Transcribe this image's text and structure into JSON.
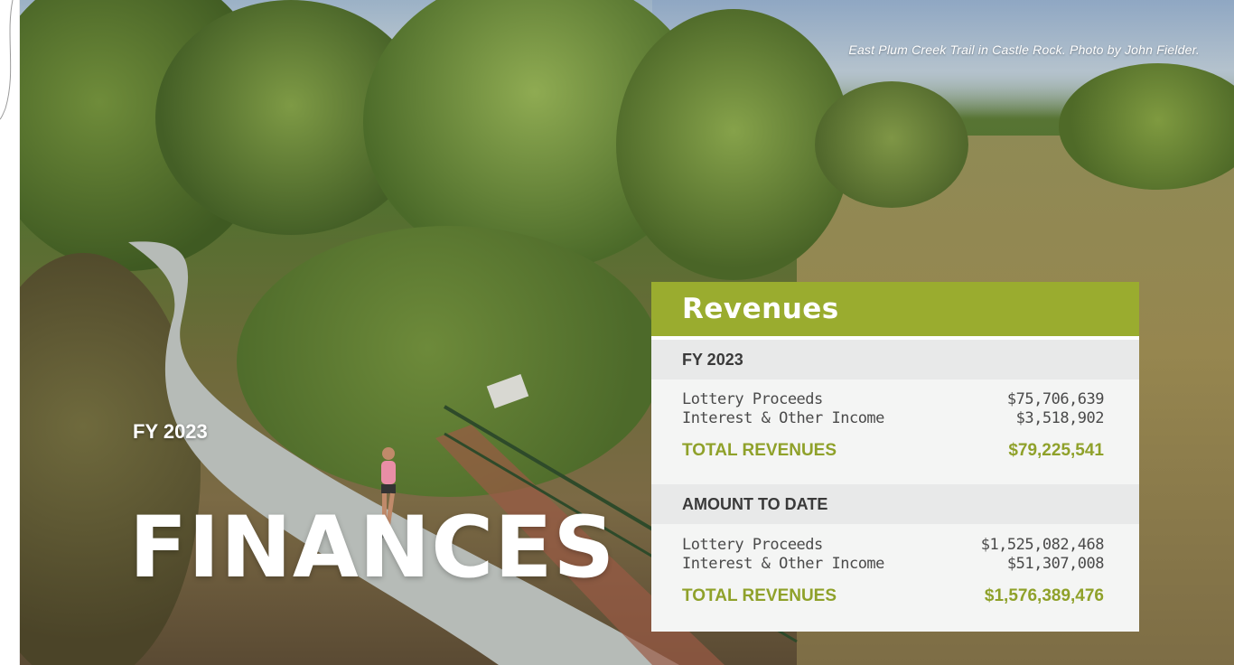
{
  "photo": {
    "caption": "East Plum Creek Trail in Castle Rock. Photo by John Fielder."
  },
  "cover": {
    "fy_label": "FY 2023",
    "title": "FINANCES"
  },
  "revenues": {
    "title": "Revenues",
    "accent_color": "#9aac2f",
    "fy_section": {
      "heading": "FY 2023",
      "rows": [
        {
          "label": "Lottery Proceeds",
          "value": "$75,706,639"
        },
        {
          "label": "Interest & Other Income",
          "value": "$3,518,902"
        }
      ],
      "total_label": "TOTAL REVENUES",
      "total_value": "$79,225,541"
    },
    "to_date_section": {
      "heading": "AMOUNT TO DATE",
      "rows": [
        {
          "label": "Lottery Proceeds",
          "value": "$1,525,082,468"
        },
        {
          "label": "Interest & Other Income",
          "value": "$51,307,008"
        }
      ],
      "total_label": "TOTAL REVENUES",
      "total_value": "$1,576,389,476"
    }
  }
}
